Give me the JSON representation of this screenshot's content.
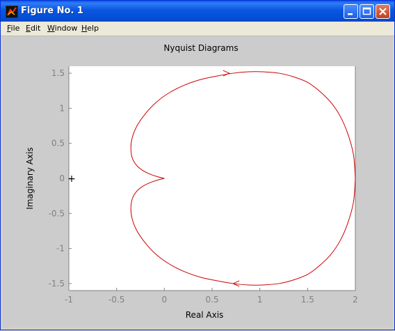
{
  "window": {
    "title": "Figure No. 1"
  },
  "menubar": {
    "items": [
      "File",
      "Edit",
      "Window",
      "Help"
    ]
  },
  "colors": {
    "figure_bg": "#cccccc",
    "curve": "#cc0000",
    "axes_text": "#000000"
  },
  "icons": [
    "matlab-app-icon",
    "minimize-icon",
    "maximize-icon",
    "close-icon"
  ],
  "chart_data": {
    "type": "line",
    "title": "Nyquist Diagrams",
    "xlabel": "Real Axis",
    "ylabel": "Imaginary Axis",
    "xlim": [
      -1,
      2
    ],
    "ylim": [
      -1.6,
      1.6
    ],
    "xticks": [
      "-1",
      "-0.5",
      "0",
      "0.5",
      "1",
      "1.5",
      "2"
    ],
    "yticks": [
      "1.5",
      "1",
      "0.5",
      "0",
      "-0.5",
      "-1",
      "-1.5"
    ],
    "grid": false,
    "marker": {
      "label": "+",
      "x": -1,
      "y": 0
    },
    "series": [
      {
        "x": [
          2.0,
          1.98,
          1.92,
          1.84,
          1.74,
          1.62,
          1.5,
          1.35,
          1.2,
          1.03,
          0.88,
          0.72,
          0.55,
          0.38,
          0.21,
          0.05,
          -0.09,
          -0.2,
          -0.29,
          -0.34,
          -0.35,
          -0.33,
          -0.28,
          -0.21,
          -0.13,
          -0.06,
          0.0
        ],
        "y": [
          0.0,
          0.34,
          0.64,
          0.89,
          1.09,
          1.25,
          1.37,
          1.45,
          1.5,
          1.52,
          1.52,
          1.5,
          1.46,
          1.41,
          1.33,
          1.22,
          1.08,
          0.92,
          0.74,
          0.56,
          0.4,
          0.27,
          0.17,
          0.1,
          0.05,
          0.02,
          0.0
        ]
      },
      {
        "x": [
          2.0,
          1.98,
          1.92,
          1.84,
          1.74,
          1.62,
          1.5,
          1.35,
          1.2,
          1.03,
          0.88,
          0.72,
          0.55,
          0.38,
          0.21,
          0.05,
          -0.09,
          -0.2,
          -0.29,
          -0.34,
          -0.35,
          -0.33,
          -0.28,
          -0.21,
          -0.13,
          -0.06,
          0.0
        ],
        "y": [
          0.0,
          -0.34,
          -0.64,
          -0.89,
          -1.09,
          -1.25,
          -1.37,
          -1.45,
          -1.5,
          -1.52,
          -1.52,
          -1.5,
          -1.46,
          -1.41,
          -1.33,
          -1.22,
          -1.08,
          -0.92,
          -0.74,
          -0.56,
          -0.4,
          -0.27,
          -0.17,
          -0.1,
          -0.05,
          -0.02,
          0.0
        ]
      }
    ],
    "arrows": [
      {
        "x": 0.68,
        "y": 1.5,
        "direction": "right"
      },
      {
        "x": 0.72,
        "y": -1.5,
        "direction": "left"
      }
    ]
  }
}
